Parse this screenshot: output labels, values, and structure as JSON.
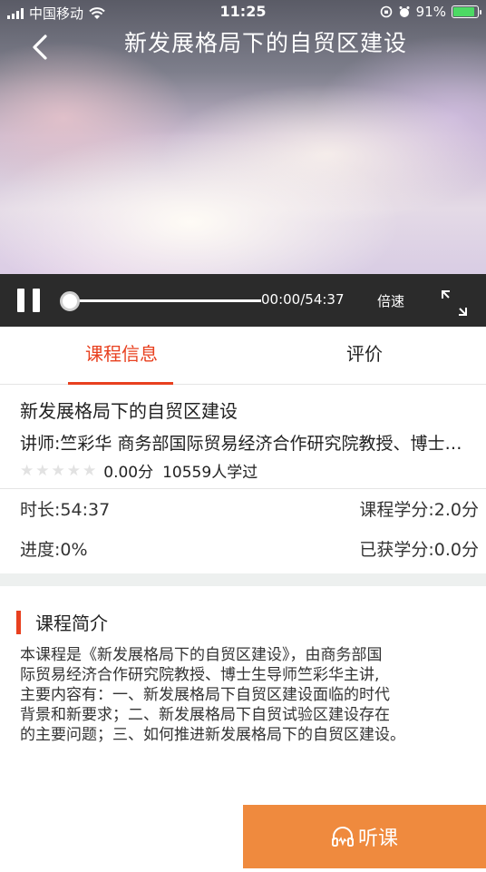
{
  "statusbar": {
    "carrier": "中国移动",
    "time": "11:25",
    "battery": "91%"
  },
  "header": {
    "title": "新发展格局下的自贸区建设"
  },
  "player": {
    "time_display": "00:00/54:37",
    "speed_label": "倍速",
    "progress": 0
  },
  "tabs": [
    {
      "label": "课程信息",
      "active": true
    },
    {
      "label": "评价",
      "active": false
    }
  ],
  "course": {
    "title": "新发展格局下的自贸区建设",
    "lecturer": "讲师:竺彩华 商务部国际贸易经济合作研究院教授、博士生导师",
    "rating": {
      "stars": 0,
      "max_stars": 5,
      "score_text": "0.00分",
      "learners_text": "10559人学过"
    },
    "duration": "时长:54:37",
    "credit": "课程学分:2.0分",
    "progress": "进度:0%",
    "earned_credit": "已获学分:0.0分"
  },
  "intro": {
    "heading": "课程简介",
    "lines": [
      "本课程是《新发展格局下的自贸区建设》，由商务部国",
      "际贸易经济合作研究院教授、博士生导师竺彩华主讲,",
      "主要内容有：一、新发展格局下自贸区建设面临的时代",
      "背景和新要求；二、新发展格局下自贸试验区建设存在",
      "的主要问题；三、如何推进新发展格局下的自贸区建设。"
    ]
  },
  "listen_button": {
    "label": "听课"
  },
  "colors": {
    "accent": "#e8401f",
    "listen_button": "#ef8a3e",
    "controls_bg": "#2b2b2b"
  }
}
